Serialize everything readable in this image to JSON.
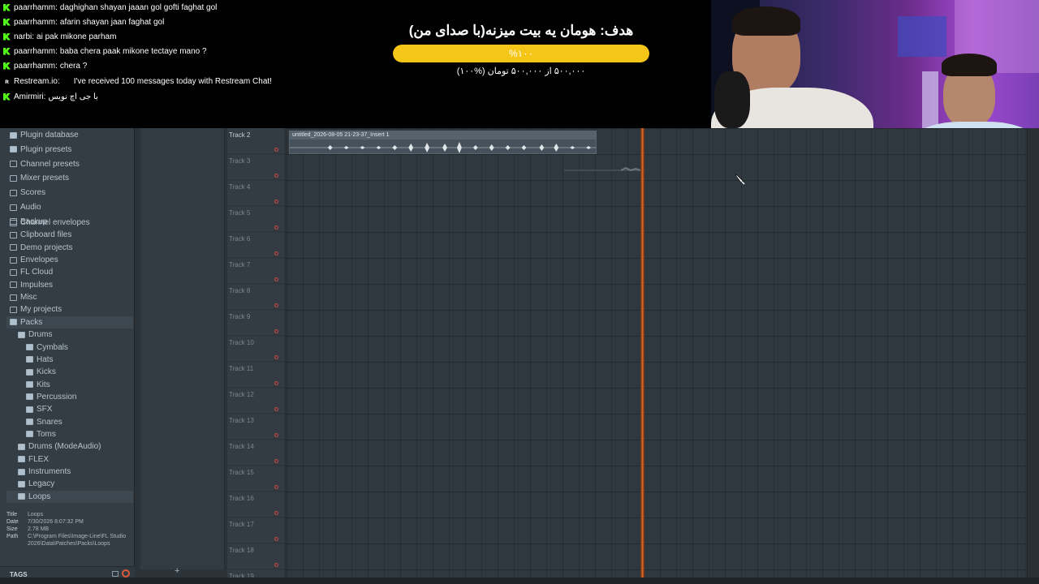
{
  "chat": {
    "messages": [
      {
        "badge": "kick",
        "user": "paarrhamm:",
        "text": "daghighan shayan jaaan gol gofti faghat gol"
      },
      {
        "badge": "kick",
        "user": "paarrhamm:",
        "text": "afarin shayan jaan faghat gol"
      },
      {
        "badge": "kick",
        "user": "narbi:",
        "text": "ai pak mikone parham"
      },
      {
        "badge": "kick",
        "user": "paarrhamm:",
        "text": "baba chera paak mikone tectaye mano ?"
      },
      {
        "badge": "kick",
        "user": "paarrhamm:",
        "text": "chera ?"
      },
      {
        "badge": "restream",
        "user": "Restream.io:",
        "text": "I've received 100 messages today with Restream Chat!"
      },
      {
        "badge": "kick",
        "user": "Amirmiri:",
        "text": "با جی اچ نویس"
      }
    ]
  },
  "goal": {
    "title": "هدف: هومان یه بیت میزنه(با صدای من)",
    "percent_label": "%۱۰۰",
    "progress": 1.0,
    "subtitle": "۵۰۰,۰۰۰ از ۵۰۰,۰۰۰ تومان (%۱۰۰)",
    "accent_color": "#f5c518"
  },
  "browser": {
    "items": [
      {
        "label": "Plugin database",
        "level": 0,
        "icon": "plugin-icon"
      },
      {
        "label": "Plugin presets",
        "level": 0,
        "icon": "plugin-icon"
      },
      {
        "label": "Channel presets",
        "level": 0,
        "icon": "folder-icon"
      },
      {
        "label": "Mixer presets",
        "level": 0,
        "icon": "folder-icon"
      },
      {
        "label": "Scores",
        "level": 0,
        "icon": "note-icon"
      },
      {
        "label": "Audio",
        "level": 0,
        "icon": "user-icon"
      },
      {
        "label": "Backup",
        "level": 0,
        "icon": "folder-icon"
      },
      {
        "label": "Channel envelopes",
        "level": 0,
        "icon": "folder-icon"
      },
      {
        "label": "Clipboard files",
        "level": 0,
        "icon": "folder-icon"
      },
      {
        "label": "Demo projects",
        "level": 0,
        "icon": "folder-icon"
      },
      {
        "label": "Envelopes",
        "level": 0,
        "icon": "folder-icon"
      },
      {
        "label": "FL Cloud",
        "level": 0,
        "icon": "cloud-icon"
      },
      {
        "label": "Impulses",
        "level": 0,
        "icon": "folder-icon"
      },
      {
        "label": "Misc",
        "level": 0,
        "icon": "folder-icon"
      },
      {
        "label": "My projects",
        "level": 0,
        "icon": "folder-icon"
      },
      {
        "label": "Packs",
        "level": 0,
        "icon": "open-folder-icon"
      },
      {
        "label": "Drums",
        "level": 1,
        "icon": "open-folder-icon"
      },
      {
        "label": "Cymbals",
        "level": 2,
        "icon": "open-folder-icon"
      },
      {
        "label": "Hats",
        "level": 2,
        "icon": "open-folder-icon"
      },
      {
        "label": "Kicks",
        "level": 2,
        "icon": "open-folder-icon"
      },
      {
        "label": "Kits",
        "level": 2,
        "icon": "open-folder-icon"
      },
      {
        "label": "Percussion",
        "level": 2,
        "icon": "open-folder-icon"
      },
      {
        "label": "SFX",
        "level": 2,
        "icon": "open-folder-icon"
      },
      {
        "label": "Snares",
        "level": 2,
        "icon": "open-folder-icon"
      },
      {
        "label": "Toms",
        "level": 2,
        "icon": "open-folder-icon"
      },
      {
        "label": "Drums (ModeAudio)",
        "level": 1,
        "icon": "open-folder-icon"
      },
      {
        "label": "FLEX",
        "level": 1,
        "icon": "open-folder-icon"
      },
      {
        "label": "Instruments",
        "level": 1,
        "icon": "open-folder-icon"
      },
      {
        "label": "Legacy",
        "level": 1,
        "icon": "open-folder-icon"
      },
      {
        "label": "Loops",
        "level": 1,
        "icon": "open-folder-icon"
      }
    ],
    "info": [
      {
        "key": "Title",
        "value": "Loops"
      },
      {
        "key": "Date",
        "value": "7/30/2026 8:07:32 PM"
      },
      {
        "key": "Size",
        "value": "2.78 MB"
      },
      {
        "key": "Path",
        "value": "C:\\Program Files\\Image-Line\\FL Studio 2026\\Data\\Patches\\Packs\\Loops"
      }
    ],
    "tags_label": "TAGS"
  },
  "playlist": {
    "tracks": [
      "Track 2",
      "Track 3",
      "Track 4",
      "Track 5",
      "Track 6",
      "Track 7",
      "Track 8",
      "Track 9",
      "Track 10",
      "Track 11",
      "Track 12",
      "Track 13",
      "Track 14",
      "Track 15",
      "Track 16",
      "Track 17",
      "Track 18",
      "Track 19"
    ],
    "clip_title": "untitled_2026-08-05 21-23-37_Insert 1",
    "playhead_color": "#e0692a"
  },
  "col2": {
    "add_label": "+"
  }
}
